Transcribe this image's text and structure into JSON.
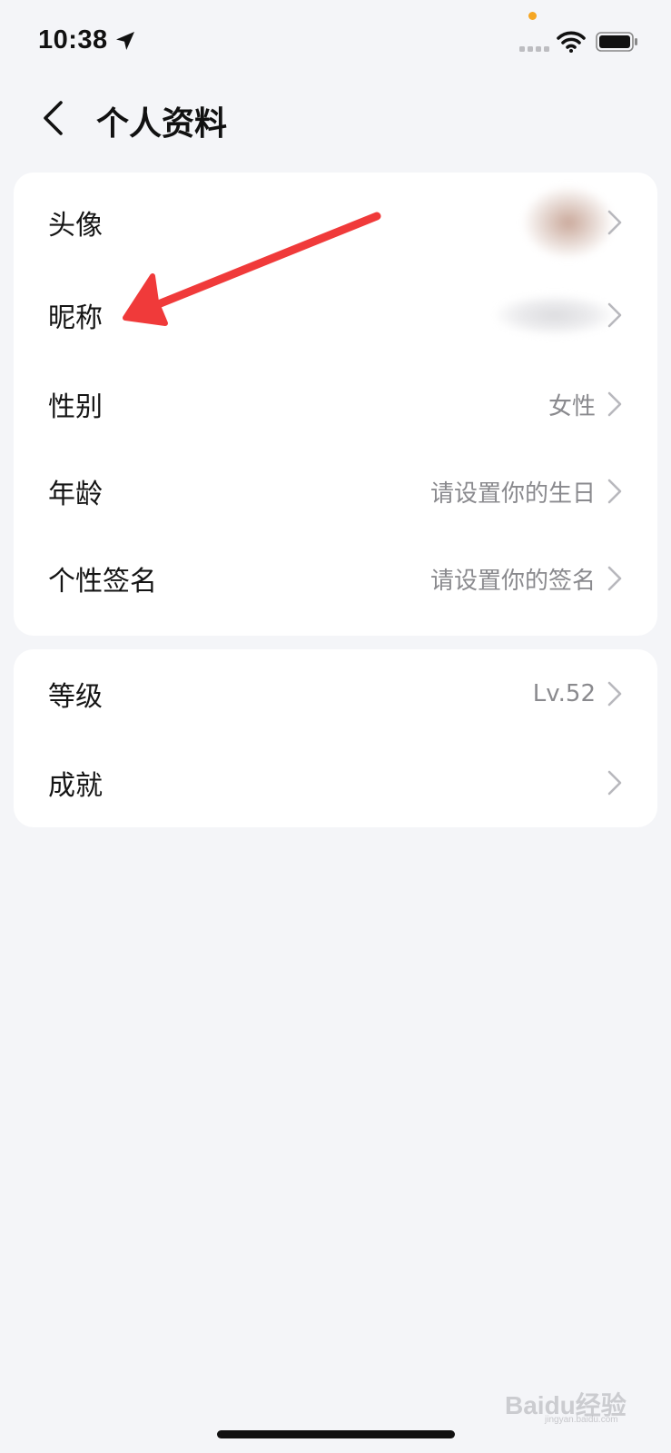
{
  "status_bar": {
    "time": "10:38",
    "icons": [
      "location-arrow-icon",
      "signal-dots-icon",
      "wifi-icon",
      "battery-icon"
    ],
    "indicator_color": "#f5a623"
  },
  "header": {
    "back_icon": "chevron-left-icon",
    "title": "个人资料"
  },
  "profile_section": {
    "rows": [
      {
        "label": "头像",
        "value": "",
        "value_kind": "blurred-avatar"
      },
      {
        "label": "昵称",
        "value": "",
        "value_kind": "blurred-text"
      },
      {
        "label": "性别",
        "value": "女性"
      },
      {
        "label": "年龄",
        "value": "请设置你的生日"
      },
      {
        "label": "个性签名",
        "value": "请设置你的签名"
      }
    ]
  },
  "stats_section": {
    "rows": [
      {
        "label": "等级",
        "value": "Lv.52"
      },
      {
        "label": "成就",
        "value": ""
      }
    ]
  },
  "annotation": {
    "type": "arrow",
    "color": "#f03a3a",
    "points_to": "昵称"
  },
  "watermark": {
    "text": "Baidu经验",
    "sub": "jingyan.baidu.com"
  },
  "colors": {
    "background": "#f4f5f8",
    "card": "#ffffff",
    "secondary_text": "#8a8a8e",
    "chevron": "#b8b8bd"
  }
}
